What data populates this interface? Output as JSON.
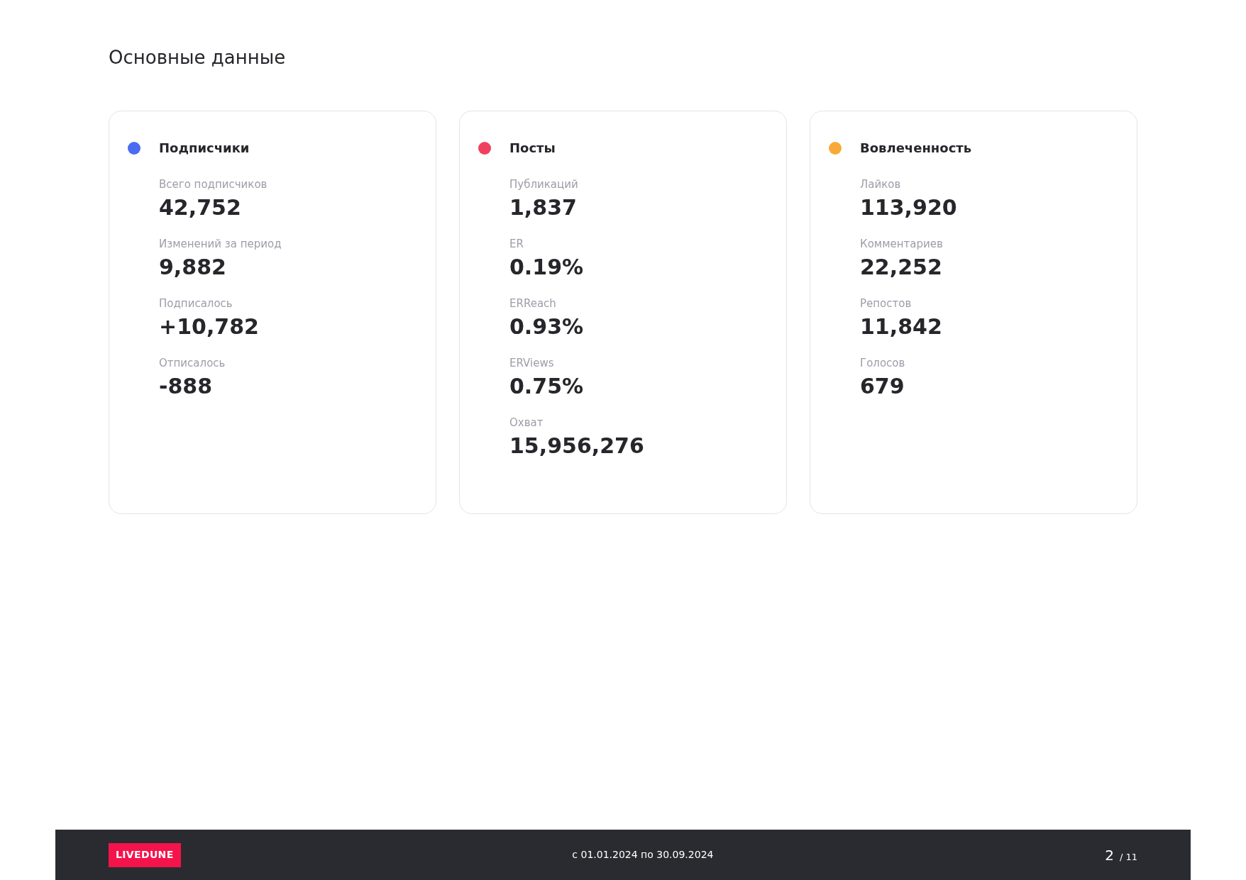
{
  "page_title": "Основные данные",
  "cards": [
    {
      "title": "Подписчики",
      "color": "#4a6cf0",
      "stats": [
        {
          "label": "Всего подписчиков",
          "value": "42,752"
        },
        {
          "label": "Изменений за период",
          "value": "9,882"
        },
        {
          "label": "Подписалось",
          "value": "+10,782"
        },
        {
          "label": "Отписалось",
          "value": "-888"
        }
      ]
    },
    {
      "title": "Посты",
      "color": "#f0405e",
      "stats": [
        {
          "label": "Публикаций",
          "value": "1,837"
        },
        {
          "label": "ER",
          "value": "0.19%"
        },
        {
          "label": "ERReach",
          "value": "0.93%"
        },
        {
          "label": "ERViews",
          "value": "0.75%"
        },
        {
          "label": "Охват",
          "value": "15,956,276"
        }
      ]
    },
    {
      "title": "Вовлеченность",
      "color": "#f9a93a",
      "stats": [
        {
          "label": "Лайков",
          "value": "113,920"
        },
        {
          "label": "Комментариев",
          "value": "22,252"
        },
        {
          "label": "Репостов",
          "value": "11,842"
        },
        {
          "label": "Голосов",
          "value": "679"
        }
      ]
    }
  ],
  "footer": {
    "logo": "LIVEDUNE",
    "period": "с 01.01.2024 по 30.09.2024",
    "page": "2",
    "total": "/ 11"
  }
}
